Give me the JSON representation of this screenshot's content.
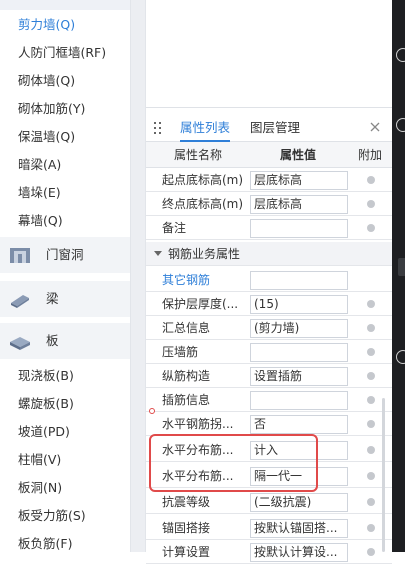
{
  "left_nav": {
    "items_top": [
      {
        "label": "剪力墙(Q)",
        "selected": true
      },
      {
        "label": "人防门框墙(RF)",
        "selected": false
      },
      {
        "label": "砌体墙(Q)",
        "selected": false
      },
      {
        "label": "砌体加筋(Y)",
        "selected": false
      },
      {
        "label": "保温墙(Q)",
        "selected": false
      },
      {
        "label": "暗梁(A)",
        "selected": false
      },
      {
        "label": "墙垛(E)",
        "selected": false
      },
      {
        "label": "幕墙(Q)",
        "selected": false
      }
    ],
    "categories": [
      {
        "label": "门窗洞",
        "icon": "door-window-icon"
      },
      {
        "label": "梁",
        "icon": "beam-icon"
      },
      {
        "label": "板",
        "icon": "slab-icon"
      }
    ],
    "items_bottom": [
      {
        "label": "现浇板(B)"
      },
      {
        "label": "螺旋板(B)"
      },
      {
        "label": "坡道(PD)"
      },
      {
        "label": "柱帽(V)"
      },
      {
        "label": "板洞(N)"
      },
      {
        "label": "板受力筋(S)"
      },
      {
        "label": "板负筋(F)"
      }
    ]
  },
  "panel": {
    "tabs": [
      {
        "label": "属性列表",
        "active": true
      },
      {
        "label": "图层管理",
        "active": false
      }
    ],
    "close_icon": "close-icon",
    "table": {
      "headers": {
        "name": "属性名称",
        "value": "属性值",
        "extra": "附加"
      },
      "rows_before_group": [
        {
          "name": "起点底标高(m)",
          "value": "层底标高",
          "dot": true
        },
        {
          "name": "终点底标高(m)",
          "value": "层底标高",
          "dot": true
        },
        {
          "name": "备注",
          "value": "",
          "dot": true
        }
      ],
      "group": {
        "label": "钢筋业务属性"
      },
      "rows_after_group": [
        {
          "name": "其它钢筋",
          "value": "",
          "dot": false,
          "link": true
        },
        {
          "name": "保护层厚度(...",
          "value": "(15)",
          "dot": true
        },
        {
          "name": "汇总信息",
          "value": "(剪力墙)",
          "dot": true
        },
        {
          "name": "压墙筋",
          "value": "",
          "dot": true
        },
        {
          "name": "纵筋构造",
          "value": "设置插筋",
          "dot": true
        },
        {
          "name": "插筋信息",
          "value": "",
          "dot": true
        },
        {
          "name": "水平钢筋拐...",
          "value": "否",
          "dot": true
        },
        {
          "name": "水平分布筋...",
          "value": "计入",
          "dot": true
        },
        {
          "name": "水平分布筋...",
          "value": "隔一代一",
          "dot": true
        },
        {
          "name": "抗震等级",
          "value": "(二级抗震)",
          "dot": true
        },
        {
          "name": "锚固搭接",
          "value": "按默认锚固搭...",
          "dot": true
        },
        {
          "name": "计算设置",
          "value": "按默认计算设...",
          "dot": true
        }
      ]
    }
  },
  "colors": {
    "accent": "#2f7fd8",
    "highlight": "#e04a4a"
  }
}
